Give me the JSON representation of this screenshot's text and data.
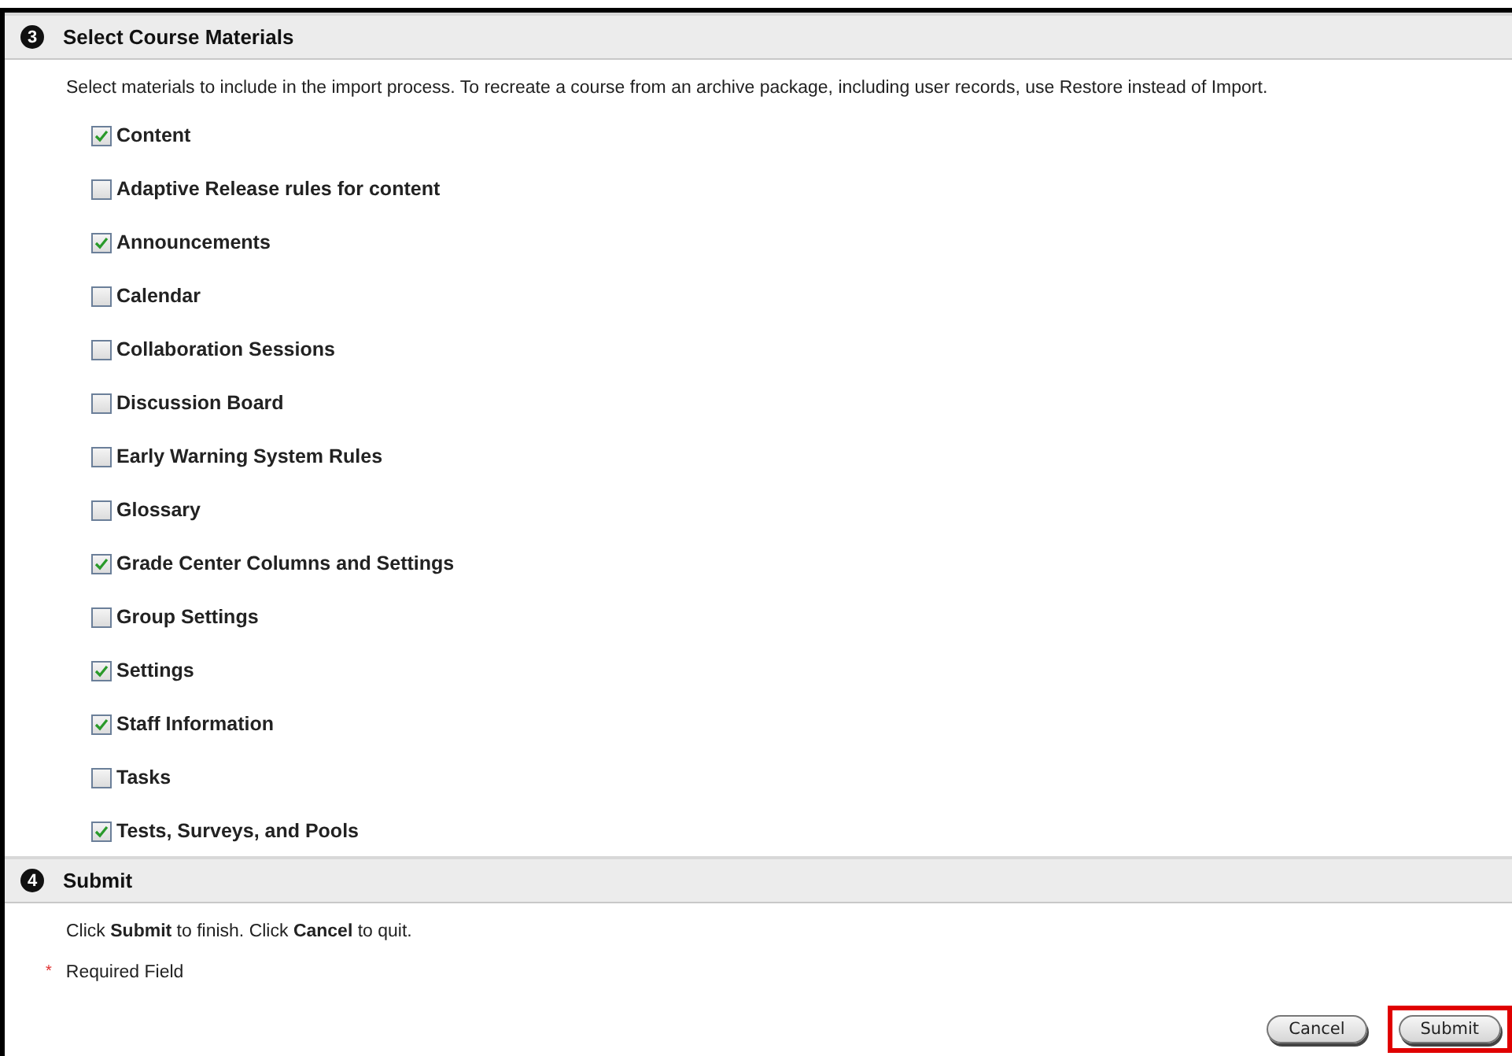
{
  "sections": [
    {
      "number": "3",
      "title": "Select Course Materials",
      "description": "Select materials to include in the import process. To recreate a course from an archive package, including user records, use Restore instead of Import.",
      "items": [
        {
          "label": "Content",
          "checked": true
        },
        {
          "label": "Adaptive Release rules for content",
          "checked": false
        },
        {
          "label": "Announcements",
          "checked": true
        },
        {
          "label": "Calendar",
          "checked": false
        },
        {
          "label": "Collaboration Sessions",
          "checked": false
        },
        {
          "label": "Discussion Board",
          "checked": false
        },
        {
          "label": "Early Warning System Rules",
          "checked": false
        },
        {
          "label": "Glossary",
          "checked": false
        },
        {
          "label": "Grade Center Columns and Settings",
          "checked": true
        },
        {
          "label": "Group Settings",
          "checked": false
        },
        {
          "label": "Settings",
          "checked": true
        },
        {
          "label": "Staff Information",
          "checked": true
        },
        {
          "label": "Tasks",
          "checked": false
        },
        {
          "label": "Tests, Surveys, and Pools",
          "checked": true
        }
      ]
    },
    {
      "number": "4",
      "title": "Submit",
      "description": "Click **Submit** to finish. Click **Cancel** to quit.",
      "required_note": {
        "mark": "*",
        "text": "Required Field"
      }
    }
  ],
  "buttons": [
    {
      "label": "Cancel",
      "highlighted": false
    },
    {
      "label": "Submit",
      "highlighted": true
    }
  ]
}
